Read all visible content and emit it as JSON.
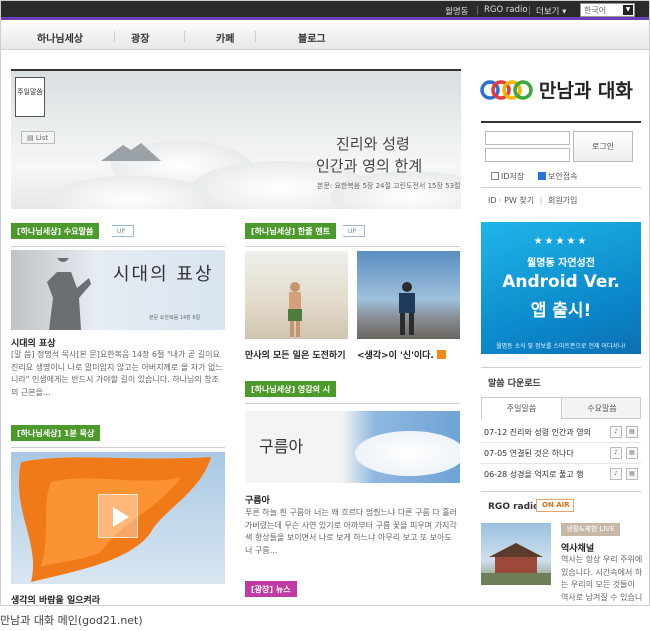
{
  "topbar": {
    "links": [
      "월명동",
      "RGO radio",
      "더보기"
    ],
    "lang_select": "한국어"
  },
  "nav": {
    "items": [
      "하나님세상",
      "광장",
      "카페",
      "블로그"
    ]
  },
  "hero": {
    "tag": "주일말씀",
    "list_button": "List",
    "title_line1": "진리와 성령",
    "title_line2": "인간과 영의 한계",
    "reference": "본문: 요한복음 5장 24절 고린도전서 15장 53절"
  },
  "left": {
    "sermon": {
      "badge": "[하나님세상] 수요말씀",
      "up": "UP",
      "image_title": "시대의 표상",
      "image_sub": "본문 요한복음 14장 6절",
      "title": "시대의 표상",
      "desc": "[말 씀] 정명석 목사[본 문]요한복음 14장 6절 \"내가 곧 길이요 진리요 생명이니 나로 말미암지 않고는 아버지께로 올 자가 없느니라\" 인생에게는 반드시 가야할 길이 있습니다. 하나님의 창조의 근본을..."
    },
    "meditation": {
      "badge": "[하나님세상] 1분 묵상",
      "title": "생각의 바람을 일으켜라"
    }
  },
  "middle": {
    "ment": {
      "badge": "[하나님세상] 한줄 멘트",
      "up": "UP",
      "item1_title": "만사의 모든 일은 도전하기",
      "item2_title": "<생각>이 '신'이다."
    },
    "poem": {
      "badge": "[하나님세상] 영감의 시",
      "image_title": "구름아",
      "title": "구름아",
      "desc": "푸른 하늘 흰 구름아 너는 왜 흐르다 멈췄느냐 다른 구름 다 흘러가버렸는데 무슨 사연 있기로 아까부터 구름 꽃을 피우며 가지각색 형상들을 보이면서 나로 보게 하느냐 아무리 보고 또 보아도 너 구름..."
    },
    "news": {
      "badge": "[광장] 뉴스"
    }
  },
  "right": {
    "logo_text": "만남과 대화",
    "login_button": "로그인",
    "id_save": "ID저장",
    "secure": "보안접속",
    "links": [
      "ID · PW 찾기",
      "회원가입"
    ],
    "android": {
      "stars": "★★★★★",
      "line1": "월명동 자연성전",
      "line2": "Android Ver.",
      "line3": "앱 출시!",
      "line4": "월명동 소식 및 정보를 스마트폰으로 언제 어디서나!"
    },
    "download": {
      "title": "말씀 다운로드",
      "tabs": [
        "주일말씀",
        "수요말씀"
      ],
      "items": [
        "07-12 진리와 성령 인간과 영의",
        "07-05 연결된 것은 하나다",
        "06-28 성경을 억지로 풀고 행"
      ]
    },
    "radio": {
      "title": "RGO radio",
      "onair": "ON AIR",
      "live": "생활&체험 LIVE",
      "channel": "역사채널",
      "desc": "역사는 항상 우리 주위에 있습니다. 시간속에서 하는 우리의 모든 것들이 역사로 남겨질 수 있습니다. 과거와 현재와 미래의"
    }
  },
  "caption": "만남과 대화 메인(god21.net)",
  "colors": {
    "topbar": "#2a2a2a",
    "accent": "#6a3fb8",
    "badge_green": "#4d9a2c",
    "badge_magenta": "#c03aa3",
    "android_blue": "#0a85c8"
  }
}
